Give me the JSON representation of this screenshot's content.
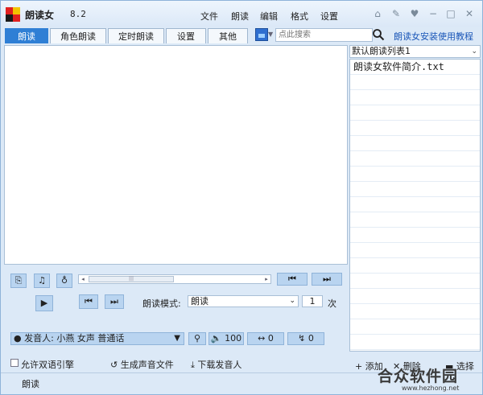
{
  "app": {
    "title": "朗读女",
    "version": "8.2"
  },
  "menu": [
    "文件",
    "朗读",
    "编辑",
    "格式",
    "设置"
  ],
  "tabs": [
    "朗读",
    "角色朗读",
    "定时朗读",
    "设置",
    "其他"
  ],
  "search": {
    "placeholder": "点此搜索"
  },
  "guide_link": "朗读女安装使用教程",
  "playlist": {
    "selected": "默认朗读列表1",
    "items": [
      "朗读女软件简介.txt"
    ]
  },
  "reading_mode": {
    "label": "朗读模式:",
    "value": "朗读",
    "count": "1",
    "count_unit": "次"
  },
  "voice": {
    "label": "发音人:",
    "value": "小燕 女声 普通话",
    "volume": "100",
    "speed": "0",
    "pitch": "0"
  },
  "options": {
    "dual_engine": "允许双语引擎",
    "generate_audio": "生成声音文件",
    "download_voice": "下载发音人"
  },
  "list_actions": {
    "add": "添加",
    "delete": "删除",
    "more": "选择"
  },
  "status": {
    "text": "朗读"
  },
  "watermark": {
    "cn": "合众软件园",
    "url": "www.hezhong.net"
  },
  "colors": {
    "accent": "#2f7fd5",
    "panel": "#dce9f7",
    "link": "#1a56b8"
  }
}
